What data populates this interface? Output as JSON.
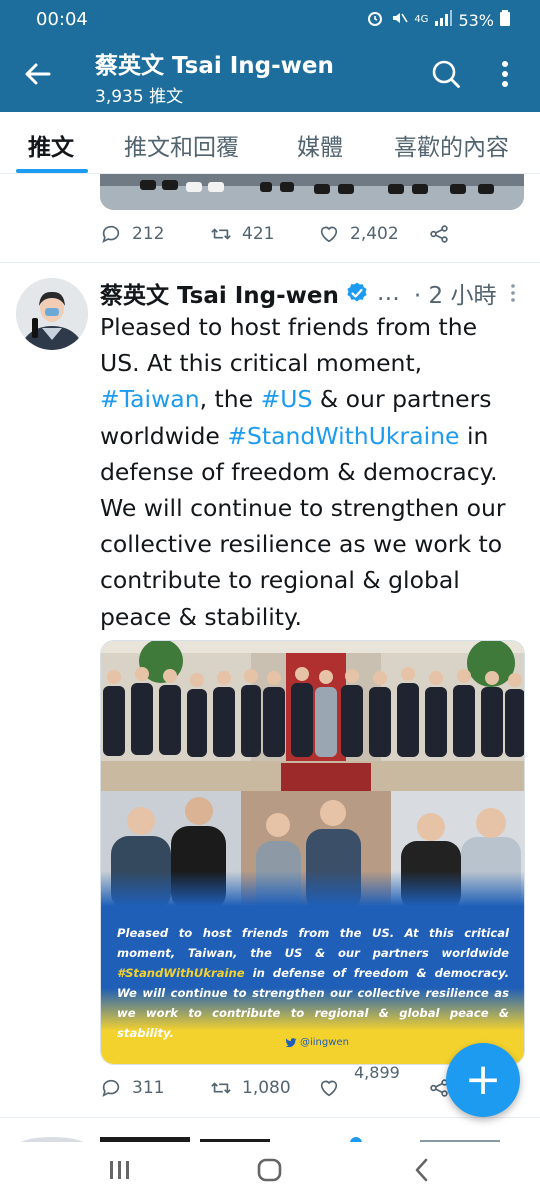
{
  "status_bar": {
    "time": "00:04",
    "network": "4G",
    "battery": "53%"
  },
  "header": {
    "name": "蔡英文 Tsai Ing-wen",
    "tweet_count": "3,935 推文",
    "back_icon": "arrow-left-icon",
    "search_icon": "search-icon",
    "more_icon": "more-vertical-icon"
  },
  "tabs": [
    {
      "label": "推文",
      "active": true
    },
    {
      "label": "推文和回覆",
      "active": false
    },
    {
      "label": "媒體",
      "active": false
    },
    {
      "label": "喜歡的內容",
      "active": false
    }
  ],
  "previous_tweet": {
    "replies": "212",
    "retweets": "421",
    "likes": "2,402"
  },
  "tweet": {
    "author": "蔡英文 Tsai Ing-wen",
    "ellipsis": "…",
    "time": "· 2 小時",
    "text": {
      "line1": "Pleased to host friends from the US. At this critical moment,",
      "tag_taiwan": "#Taiwan",
      "mid1": ", the ",
      "tag_us": "#US",
      "mid2": " & our partners worldwide ",
      "tag_swu": "#StandWithUkraine",
      "rest": " in defense of freedom & democracy. We will continue to strengthen our collective resilience as we work to contribute to regional & global peace & stability."
    },
    "image": {
      "caption": "Pleased to host friends from the US. At this critical moment, Taiwan, the US & our partners worldwide ",
      "caption_tag": "#StandWithUkraine",
      "caption_rest": " in defense of freedom & democracy. We will continue to strengthen our collective resilience as we work to contribute to regional & global peace & stability.",
      "handle": "@iingwen"
    },
    "replies": "311",
    "retweets": "1,080",
    "likes": "4,899"
  },
  "fab_label": "+",
  "colors": {
    "header_bg": "#1d6e9d",
    "accent": "#1d9bf0",
    "muted": "#536471",
    "ukraine_blue": "#1f5fb8",
    "ukraine_yellow": "#f4d22e"
  }
}
